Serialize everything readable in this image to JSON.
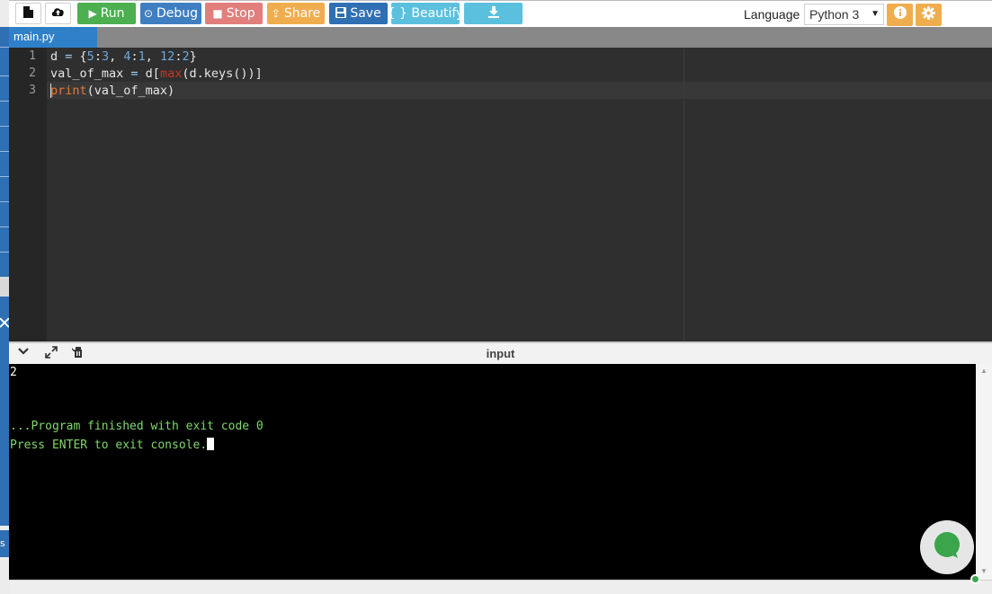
{
  "toolbar": {
    "run_label": "Run",
    "debug_label": "Debug",
    "stop_label": "Stop",
    "share_label": "Share",
    "save_label": "Save",
    "beautify_label": "{ } Beautify",
    "language_label": "Language",
    "language_value": "Python 3"
  },
  "tabs": [
    {
      "label": "main.py",
      "active": true
    }
  ],
  "editor": {
    "line_numbers": [
      "1",
      "2",
      "3"
    ],
    "lines": [
      [
        {
          "t": "d ",
          "c": "var"
        },
        {
          "t": "=",
          "c": "op"
        },
        {
          "t": " {",
          "c": "var"
        },
        {
          "t": "5",
          "c": "num"
        },
        {
          "t": ":",
          "c": "var"
        },
        {
          "t": "3",
          "c": "num"
        },
        {
          "t": ", ",
          "c": "var"
        },
        {
          "t": "4",
          "c": "num"
        },
        {
          "t": ":",
          "c": "var"
        },
        {
          "t": "1",
          "c": "num"
        },
        {
          "t": ", ",
          "c": "var"
        },
        {
          "t": "12",
          "c": "num"
        },
        {
          "t": ":",
          "c": "var"
        },
        {
          "t": "2",
          "c": "num"
        },
        {
          "t": "}",
          "c": "var"
        }
      ],
      [
        {
          "t": "val_of_max ",
          "c": "var"
        },
        {
          "t": "=",
          "c": "op"
        },
        {
          "t": " d[",
          "c": "var"
        },
        {
          "t": "max",
          "c": "fn"
        },
        {
          "t": "(d.keys())]",
          "c": "var"
        }
      ],
      [
        {
          "t": "print",
          "c": "kw"
        },
        {
          "t": "(val_of_max)",
          "c": "var"
        }
      ]
    ]
  },
  "console": {
    "header_title": "input",
    "output_lines": [
      "2",
      "",
      "",
      "...Program finished with exit code 0",
      "Press ENTER to exit console."
    ]
  },
  "colors": {
    "run": "#4caf50",
    "debug": "#3f7fc1",
    "stop": "#d9534f",
    "share": "#f0ad4e",
    "save": "#2f6fb3",
    "beautify": "#5bc0de",
    "tab_active": "#2f80c9",
    "console_green": "#7fd86b"
  }
}
